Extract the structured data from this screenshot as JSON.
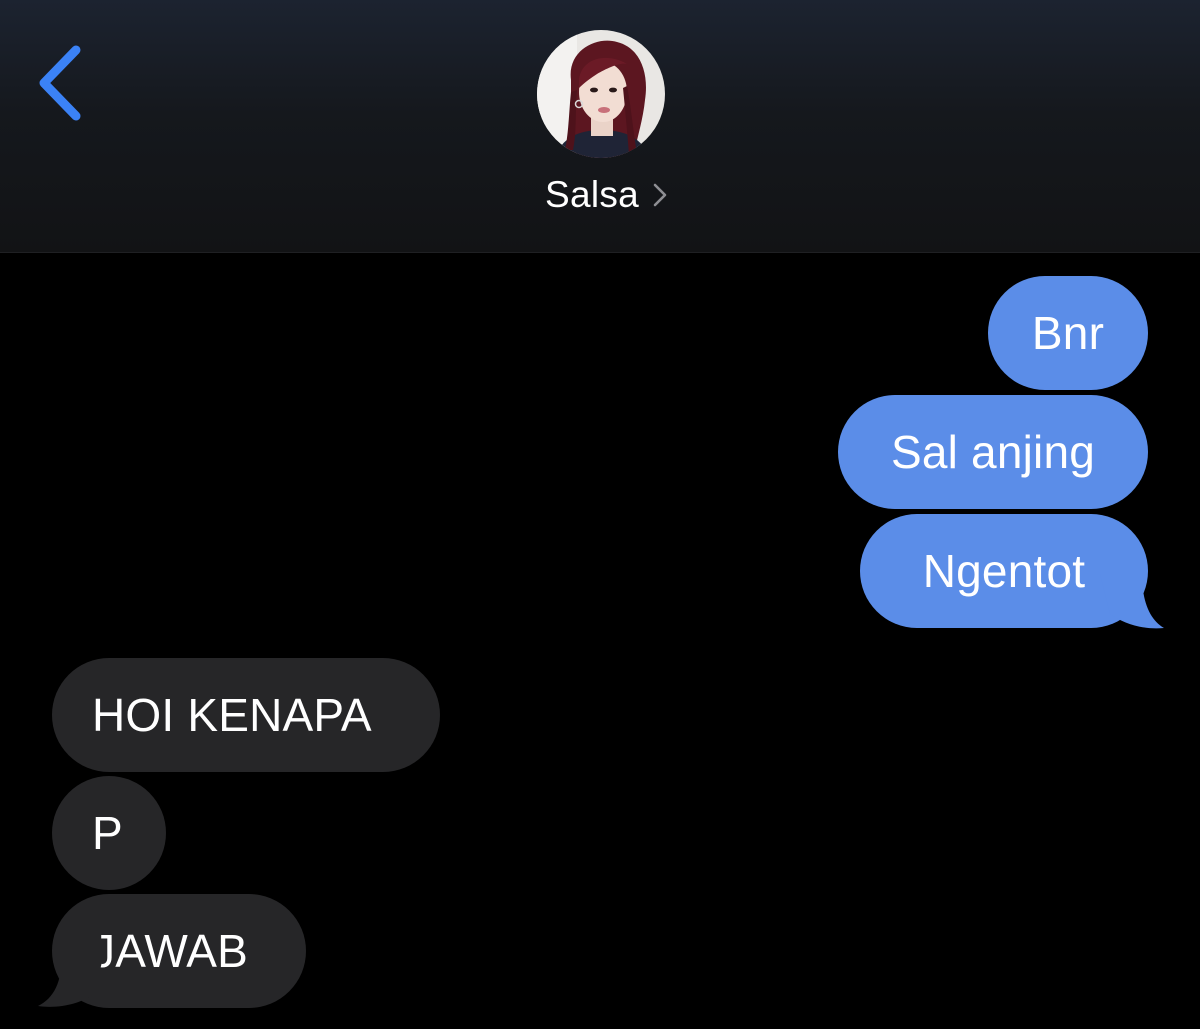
{
  "header": {
    "contact_name": "Salsa",
    "icons": {
      "back": "chevron-left-icon",
      "contact_details": "chevron-right-icon"
    }
  },
  "messages": {
    "sent": [
      "Bnr",
      "Sal anjing",
      "Ngentot"
    ],
    "received": [
      "HOI KENAPA",
      "P",
      "JAWAB"
    ]
  },
  "colors": {
    "sent_bubble": "#5b8de8",
    "received_bubble": "#262628",
    "accent_blue": "#3b82f6",
    "background": "#000000"
  }
}
